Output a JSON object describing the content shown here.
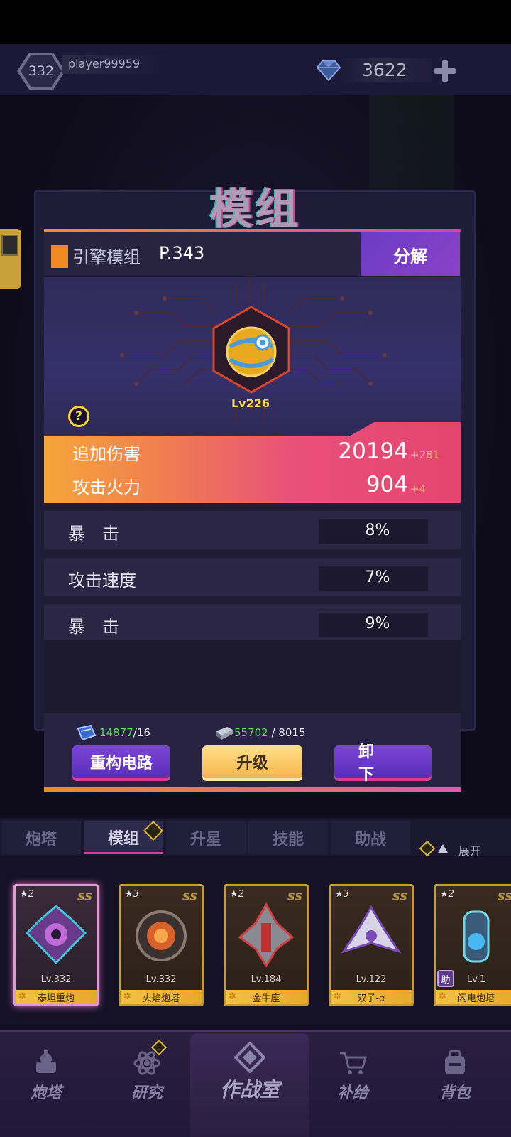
{
  "header": {
    "level": "332",
    "player_name": "player99959",
    "gem_count": "3622"
  },
  "screen_title": "模组",
  "module": {
    "type_name": "引擎模组",
    "power": "P.343",
    "level": "Lv226",
    "decompose_label": "分解",
    "rarity_color": "#f08a22"
  },
  "main_stats": [
    {
      "label": "追加伤害",
      "value": "20194",
      "increase": "+281"
    },
    {
      "label": "攻击火力",
      "value": "904",
      "increase": "+4"
    }
  ],
  "sub_stats": [
    {
      "label": "暴　击",
      "value": "8%"
    },
    {
      "label": "攻击速度",
      "value": "7%"
    },
    {
      "label": "暴　击",
      "value": "9%"
    }
  ],
  "costs": {
    "book": {
      "have": "14877",
      "need": "/16"
    },
    "metal": {
      "have": "55702",
      "need": " / 8015"
    }
  },
  "actions": {
    "rebuild": "重构电路",
    "upgrade": "升级",
    "unequip": "卸下"
  },
  "tabs": [
    "炮塔",
    "模组",
    "升星",
    "技能",
    "助战"
  ],
  "expand_label": "展开",
  "cards": [
    {
      "stars": "★2",
      "badge": "SS",
      "level": "Lv.332",
      "name": "泰坦重炮"
    },
    {
      "stars": "★3",
      "badge": "SS",
      "level": "Lv.332",
      "name": "火焰炮塔"
    },
    {
      "stars": "★2",
      "badge": "SS",
      "level": "Lv.184",
      "name": "金牛座"
    },
    {
      "stars": "★3",
      "badge": "SS",
      "level": "Lv.122",
      "name": "双子-α"
    },
    {
      "stars": "★2",
      "badge": "SS",
      "level": "Lv.1",
      "name": "闪电炮塔",
      "helper": "助"
    }
  ],
  "nav": {
    "turret": "炮塔",
    "research": "研究",
    "battle_room": "作战室",
    "supply": "补给",
    "backpack": "背包"
  }
}
